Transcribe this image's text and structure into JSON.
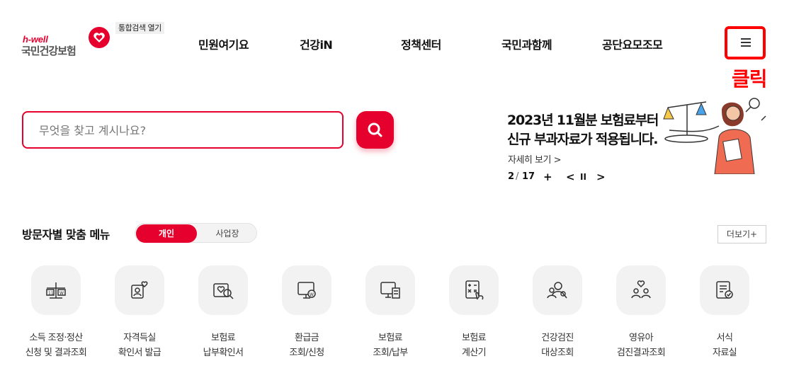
{
  "header": {
    "logo_sub": "h-well",
    "logo_main": "국민건강보험",
    "search_open_label": "통합검색 열기",
    "nav": [
      "민원여기요",
      "건강iN",
      "정책센터",
      "국민과함께",
      "공단요모조모"
    ],
    "menu_button_icon": "hamburger-menu-icon",
    "annotation_click": "클릭"
  },
  "search": {
    "placeholder": "무엇을 찾고 계시나요?",
    "button_icon": "search-icon"
  },
  "banner": {
    "line1": "2023년 11월분 보험료부터",
    "line2": "신규 부과자료가 적용됩니다.",
    "more_link": "자세히 보기 >",
    "page_current": "2",
    "page_total": "17",
    "plus": "+",
    "prev": "<",
    "pause": "II",
    "next": ">"
  },
  "visitor_menu": {
    "title": "방문자별 맞춤 메뉴",
    "tab_personal": "개인",
    "tab_business": "사업장",
    "more_button": "더보기+",
    "items": [
      {
        "label": "소득 조정·정산\n신청 및 결과조회",
        "icon": "scale-icon"
      },
      {
        "label": "자격득실\n확인서 발급",
        "icon": "person-heart-icon"
      },
      {
        "label": "보험료\n납부확인서",
        "icon": "heart-search-icon"
      },
      {
        "label": "환급금\n조회/신청",
        "icon": "monitor-won-icon"
      },
      {
        "label": "보험료\n조회/납부",
        "icon": "monitor-document-icon"
      },
      {
        "label": "보험료\n계산기",
        "icon": "calculator-icon"
      },
      {
        "label": "건강검진\n대상조회",
        "icon": "people-search-icon"
      },
      {
        "label": "영유아\n검진결과조회",
        "icon": "family-heart-icon"
      },
      {
        "label": "서식\n자료실",
        "icon": "form-check-icon"
      }
    ]
  },
  "colors": {
    "brand_red": "#e6002d",
    "annotation_red": "#ff0000",
    "icon_bg": "#f2f2f2"
  }
}
